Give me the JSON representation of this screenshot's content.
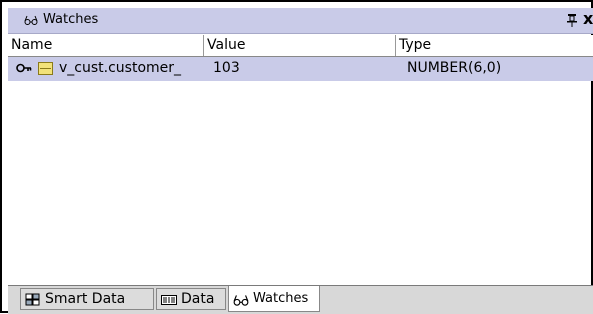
{
  "panel": {
    "title": "Watches",
    "title_icon": "glasses-icon",
    "pin_icon": "pin-icon",
    "close_label": "x"
  },
  "columns": {
    "name": "Name",
    "value": "Value",
    "type": "Type"
  },
  "rows": [
    {
      "name": "v_cust.customer_",
      "value": "103",
      "type": "NUMBER(6,0)",
      "expand_icon": "key-expand-icon",
      "var_icon": "variable-icon"
    }
  ],
  "tabs": [
    {
      "label": "Smart Data",
      "icon": "smart-data-icon"
    },
    {
      "label": "Data",
      "icon": "data-icon"
    },
    {
      "label": "Watches",
      "icon": "glasses-icon"
    }
  ],
  "colors": {
    "titlebar": "#c9cbe8",
    "selected_row": "#c9cbe8",
    "tabbar": "#d8d8d8"
  }
}
